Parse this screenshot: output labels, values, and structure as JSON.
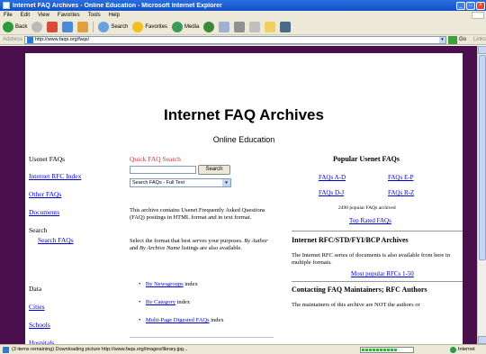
{
  "window": {
    "title": "Internet FAQ Archives - Online Education - Microsoft Internet Explorer"
  },
  "menu": [
    "File",
    "Edit",
    "View",
    "Favorites",
    "Tools",
    "Help"
  ],
  "toolbar": {
    "back": "Back",
    "search": "Search",
    "favorites": "Favorites",
    "media": "Media"
  },
  "address": {
    "label": "Address",
    "url": "http://www.faqs.org/faqs/",
    "go": "Go",
    "links": "Links"
  },
  "page": {
    "title": "Internet FAQ Archives",
    "subtitle": "Online Education"
  },
  "leftnav": {
    "usenet_faqs": "Usenet FAQs",
    "internet_rfc_index": "Internet RFC Index",
    "other_faqs": "Other FAQs",
    "documents": "Documents",
    "search": "Search",
    "search_faqs": "Search FAQs",
    "data": "Data",
    "cities": "Cities",
    "schools": "Schools",
    "hospitals": "Hospitals"
  },
  "middle": {
    "quick_search_label": "Quick FAQ Search",
    "search_button": "Search",
    "search_select": "Search FAQs - Full Text",
    "para1": "This archive contains Usenet Frequently Asked Questions (FAQ) postings in HTML format and in text format.",
    "para2_a": "Select the format that best serves your purposes. ",
    "para2_b": "By Author",
    "para2_c": " and ",
    "para2_d": "By Archive Name",
    "para2_e": " listings are also available.",
    "bullet1_link": "By Newsgroups",
    "bullet1_tail": " index",
    "bullet2_link": "By Category",
    "bullet2_tail": " index",
    "bullet3_link": "Multi-Page Digested FAQs",
    "bullet3_tail": " index"
  },
  "right": {
    "popular_heading": "Popular Usenet FAQs",
    "faqs_ad": "FAQs A-D",
    "faqs_ep": "FAQs E-P",
    "faqs_dj": "FAQs D-J",
    "faqs_rz": "FAQs R-Z",
    "archived_count": "2490 popular FAQs archived",
    "top_rated": "Top Rated FAQs",
    "rfc_heading": "Internet RFC/STD/FYI/BCP Archives",
    "rfc_text": "The Internet RFC series of documents is also available from here in multiple formats.",
    "popular_rfcs": "Most popular RFCs 1-50",
    "contact_heading": "Contacting FAQ Maintainers; RFC Authors",
    "contact_text": "The maintainers of this archive are NOT the authors or"
  },
  "status": {
    "text": "(3 items remaining) Downloading picture http://www.faqs.org/images/library.jpg...",
    "progress": 0.7,
    "zone": "Internet"
  }
}
